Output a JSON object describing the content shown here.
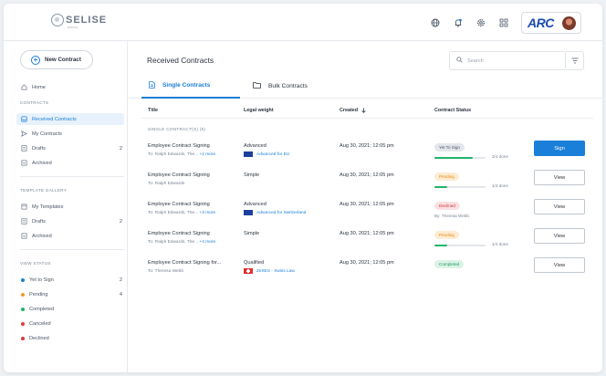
{
  "header": {
    "logo_text": "SELISE",
    "logo_sub": "DIGITAL",
    "brand_text": "ARC",
    "icons": [
      "globe-icon",
      "bell-icon",
      "gear-icon",
      "apps-grid-icon"
    ]
  },
  "sidebar": {
    "new_button": "New Contract",
    "home": "Home",
    "contracts_heading": "CONTRACTS",
    "contracts": [
      {
        "label": "Received Contracts",
        "count": "",
        "icon": "inbox-icon",
        "active": true
      },
      {
        "label": "My Contracts",
        "count": "",
        "icon": "send-icon"
      },
      {
        "label": "Drafts",
        "count": "2",
        "icon": "draft-icon"
      },
      {
        "label": "Archived",
        "count": "",
        "icon": "archive-icon"
      }
    ],
    "template_heading": "TEMPLATE GALLERY",
    "templates": [
      {
        "label": "My Templates",
        "count": "",
        "icon": "template-icon"
      },
      {
        "label": "Drafts",
        "count": "2",
        "icon": "draft-icon"
      },
      {
        "label": "Archived",
        "count": "",
        "icon": "archive-icon"
      }
    ],
    "status_heading": "VIEW STATUS",
    "statuses": [
      {
        "label": "Yet to Sign",
        "count": "2",
        "color": "#1a7fd8"
      },
      {
        "label": "Pending",
        "count": "4",
        "color": "#f29a1f"
      },
      {
        "label": "Completed",
        "count": "",
        "color": "#1fb46a"
      },
      {
        "label": "Canceled",
        "count": "",
        "color": "#e03a3a"
      },
      {
        "label": "Declined",
        "count": "",
        "color": "#e03a3a"
      }
    ]
  },
  "main": {
    "title": "Received Contracts",
    "search_placeholder": "Search",
    "tabs": [
      {
        "label": "Single Contracts",
        "active": true
      },
      {
        "label": "Bulk Contracts",
        "active": false
      }
    ],
    "columns": [
      "Title",
      "Legal weight",
      "Created",
      "Contract Status"
    ],
    "group_heading": "SINGLE CONTRACT(S) (5)",
    "rows": [
      {
        "title": "Employee Contract Signing",
        "to": "To: Ralph Edwards, The...",
        "more": "+2 more",
        "legal": "Advanced",
        "region": "Advanced for EU",
        "flag": "eu",
        "created": "Aug 30, 2021; 12:05 pm",
        "status": "Yet To Sign",
        "status_kind": "yts",
        "progress": 0.75,
        "progress_color": "#1fb46a",
        "progress_text": "3/4 done",
        "by": "",
        "action": "Sign"
      },
      {
        "title": "Employee Contract Signing",
        "to": "To: Ralph Edwards",
        "more": "",
        "legal": "Simple",
        "region": "",
        "flag": "",
        "created": "Aug 30, 2021; 12:05 pm",
        "status": "Pending",
        "status_kind": "pend",
        "progress": 0.25,
        "progress_color": "#1fb46a",
        "progress_text": "1/4 done",
        "by": "",
        "action": "View"
      },
      {
        "title": "Employee Contract Signing",
        "to": "To: Ralph Edwards, The...",
        "more": "+3 more",
        "legal": "Advanced",
        "region": "Advanced for Switzerland",
        "flag": "eu",
        "created": "Aug 30, 2021; 12:05 pm",
        "status": "Declined",
        "status_kind": "decl",
        "progress": null,
        "progress_text": "",
        "by": "By: Theresa Webb",
        "action": "View"
      },
      {
        "title": "Employee Contract Signing",
        "to": "To: Ralph Edwards, The...",
        "more": "+4 more",
        "legal": "Simple",
        "region": "",
        "flag": "",
        "created": "Aug 30, 2021; 12:05 pm",
        "status": "Pending",
        "status_kind": "pend",
        "progress": 0.25,
        "progress_color": "#1fb46a",
        "progress_text": "1/4 done",
        "by": "",
        "action": "View"
      },
      {
        "title": "Employee Contract Signing for...",
        "to": "To: Theresa Webb",
        "more": "",
        "legal": "Qualified",
        "region": "ZertES - Swiss Law",
        "flag": "ch",
        "created": "Aug 30, 2021; 12:05 pm",
        "status": "Completed",
        "status_kind": "comp",
        "progress": null,
        "progress_text": "",
        "by": "",
        "action": "View"
      }
    ]
  }
}
